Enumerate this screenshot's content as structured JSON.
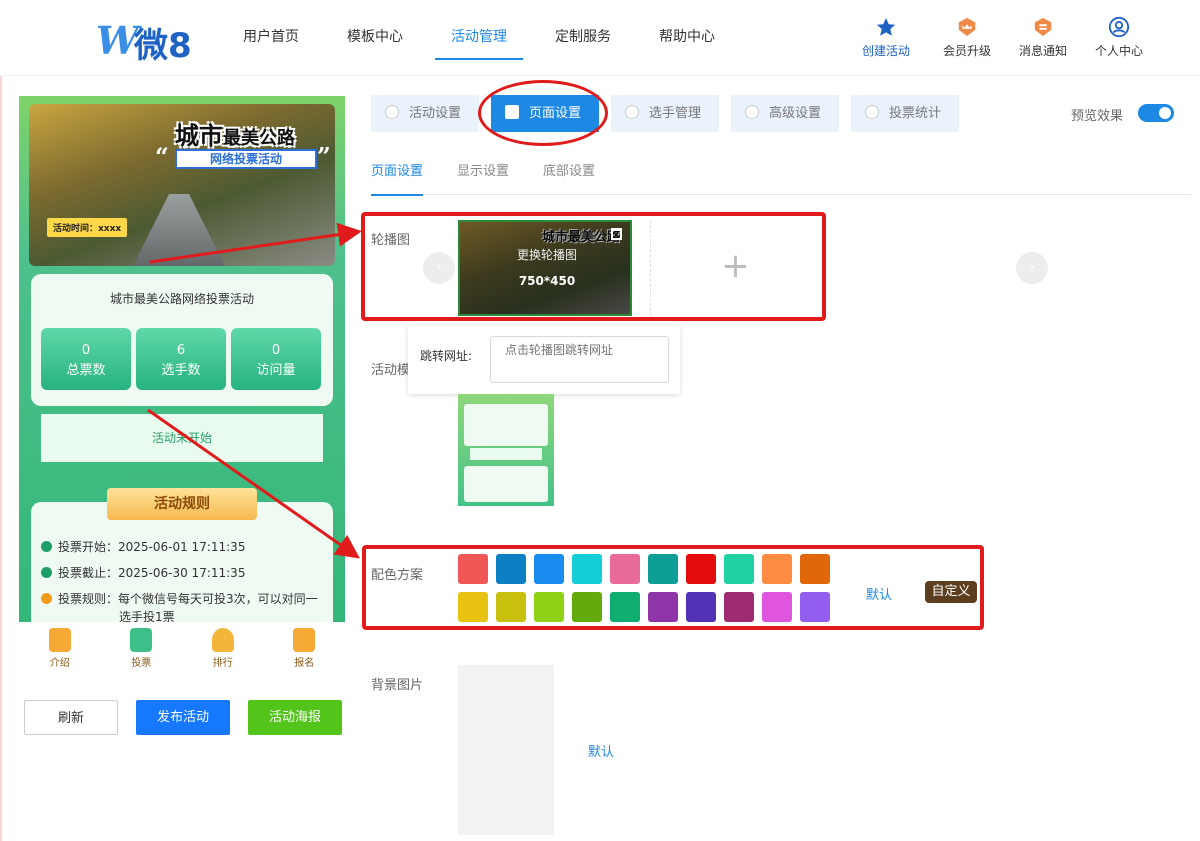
{
  "logo": {
    "mark": "W",
    "text": "微8"
  },
  "nav": {
    "links": [
      "用户首页",
      "模板中心",
      "活动管理",
      "定制服务",
      "帮助中心"
    ],
    "active": "活动管理",
    "icons": [
      {
        "label": "创建活动",
        "icon": "star-icon"
      },
      {
        "label": "会员升级",
        "icon": "crown-icon"
      },
      {
        "label": "消息通知",
        "icon": "bell-icon"
      },
      {
        "label": "个人中心",
        "icon": "user-icon"
      }
    ]
  },
  "preview": {
    "banner": {
      "title_big": "城市",
      "title_small": "最美公路",
      "subtitle": "网络投票活动",
      "time": "活动时间：xxxx"
    },
    "card_title": "城市最美公路网络投票活动",
    "stats": [
      {
        "value": "0",
        "label": "总票数"
      },
      {
        "value": "6",
        "label": "选手数"
      },
      {
        "value": "0",
        "label": "访问量"
      }
    ],
    "status": "活动未开始",
    "rules_title": "活动规则",
    "rules": [
      "投票开始：2025-06-01 17:11:35",
      "投票截止：2025-06-30 17:11:35",
      "投票规则：每个微信号每天可投3次，可以对同一",
      "选手投1票"
    ],
    "bottom_tabs": [
      "介绍",
      "投票",
      "排行",
      "报名"
    ]
  },
  "actions": {
    "refresh": "刷新",
    "publish": "发布活动",
    "poster": "活动海报"
  },
  "settings": {
    "main_tabs": [
      "活动设置",
      "页面设置",
      "选手管理",
      "高级设置",
      "投票统计"
    ],
    "main_active": "页面设置",
    "preview_label": "预览效果",
    "preview_on": true,
    "sub_tabs": [
      "页面设置",
      "显示设置",
      "底部设置"
    ],
    "sub_active": "页面设置",
    "carousel": {
      "label": "轮播图",
      "image_title": "城市最美公路",
      "replace_text": "更换轮播图",
      "size_text": "750*450",
      "add": "+"
    },
    "jump": {
      "label": "跳转网址:",
      "placeholder": "点击轮播图跳转网址"
    },
    "template_label": "活动模",
    "color": {
      "label": "配色方案",
      "default": "默认",
      "custom": "自定义",
      "swatches": [
        "#f25757",
        "#0d80c4",
        "#1a8cf0",
        "#14cfd6",
        "#e96b99",
        "#0d9e96",
        "#e30b0b",
        "#1fd1a3",
        "#ff8c42",
        "#e0680a",
        "#e8c312",
        "#c9c00d",
        "#8fd115",
        "#63ab0a",
        "#0fad70",
        "#8e35a8",
        "#5233b8",
        "#9e2b71",
        "#e055e0",
        "#915ef0"
      ]
    },
    "background": {
      "label": "背景图片",
      "default": "默认"
    }
  }
}
